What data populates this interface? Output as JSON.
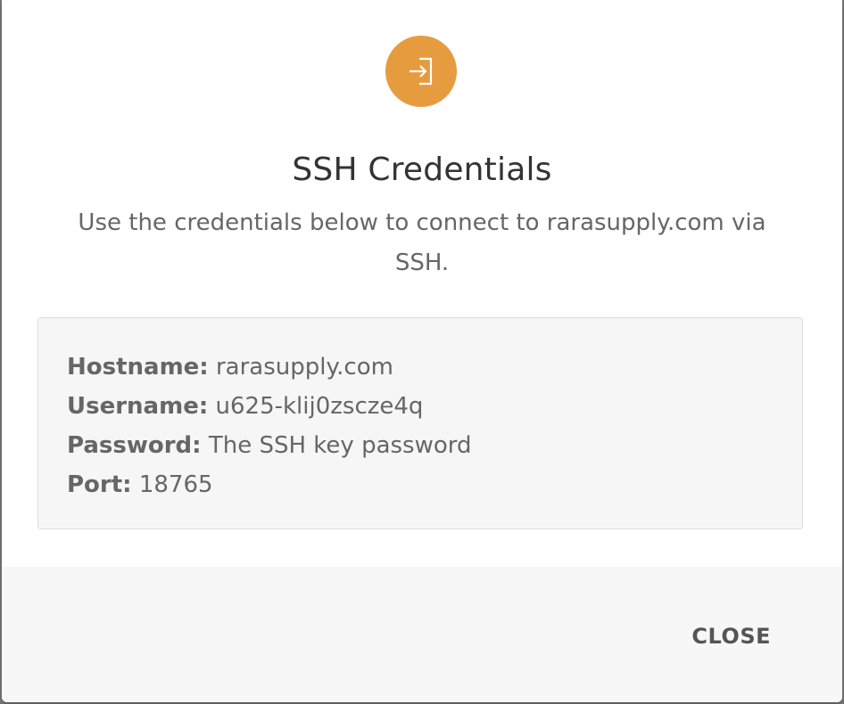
{
  "dialog": {
    "icon": "login-arrow-icon",
    "accent_color": "#e79b3f",
    "title": "SSH Credentials",
    "subtitle": "Use the credentials below to connect to rarasupply.com via SSH."
  },
  "credentials": [
    {
      "label": "Hostname:",
      "value": "rarasupply.com"
    },
    {
      "label": "Username:",
      "value": "u625-klij0zscze4q"
    },
    {
      "label": "Password:",
      "value": "The SSH key password"
    },
    {
      "label": "Port:",
      "value": "18765"
    }
  ],
  "footer": {
    "close_label": "CLOSE"
  }
}
